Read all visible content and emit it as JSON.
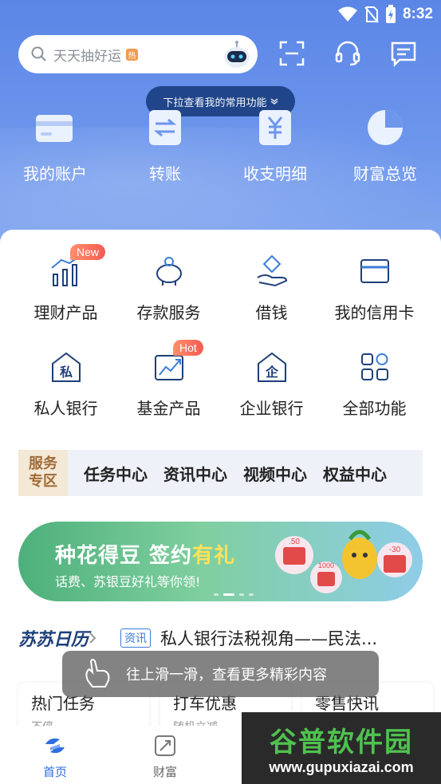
{
  "status": {
    "time": "8:32"
  },
  "search": {
    "placeholder": "天天抽好运",
    "hot_tag": "热"
  },
  "pull_hint": "下拉查看我的常用功能",
  "quick_actions": [
    {
      "label": "我的账户",
      "icon": "card-icon"
    },
    {
      "label": "转账",
      "icon": "transfer-icon"
    },
    {
      "label": "收支明细",
      "icon": "statement-icon"
    },
    {
      "label": "财富总览",
      "icon": "pie-chart-icon"
    }
  ],
  "grid_row1": [
    {
      "label": "理财产品",
      "badge": "New"
    },
    {
      "label": "存款服务"
    },
    {
      "label": "借钱"
    },
    {
      "label": "我的信用卡"
    }
  ],
  "grid_row2": [
    {
      "label": "私人银行",
      "glyph": "私"
    },
    {
      "label": "基金产品",
      "badge": "Hot"
    },
    {
      "label": "企业银行",
      "glyph": "企"
    },
    {
      "label": "全部功能"
    }
  ],
  "service": {
    "tag_line1": "服务",
    "tag_line2": "专区",
    "links": [
      "任务中心",
      "资讯中心",
      "视频中心",
      "权益中心"
    ]
  },
  "banner": {
    "title_main": "种花得豆 签约",
    "title_highlight": "有礼",
    "subtitle": "话费、苏银豆好礼等你领!",
    "coupons": [
      ".50",
      "1000",
      "-30"
    ]
  },
  "news": {
    "brand": "苏苏日历",
    "tag": "资讯",
    "text": "私人银行法税视角——民法..."
  },
  "cards": [
    {
      "title": "热门任务",
      "sub": "不停"
    },
    {
      "title": "打车优惠",
      "sub": "随机立减"
    },
    {
      "title": "零售快讯",
      "sub": ""
    }
  ],
  "toast": "往上滑一滑，查看更多精彩内容",
  "tabs": [
    {
      "label": "首页",
      "active": true
    },
    {
      "label": "财富",
      "active": false
    }
  ],
  "watermark": {
    "title": "谷普软件园",
    "url": "www.gupuxiazai.com"
  },
  "colors": {
    "hero": "#5b86e6",
    "accent": "#2f6de0",
    "badge": "#f25c52",
    "service_tag": "#a06a36"
  }
}
